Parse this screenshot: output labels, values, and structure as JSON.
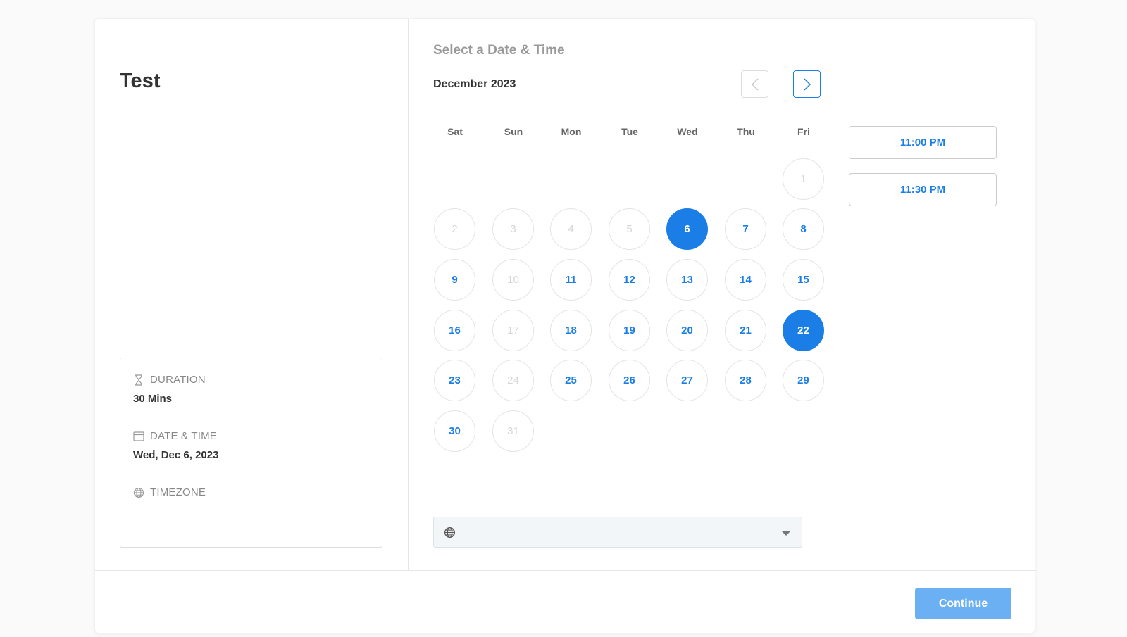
{
  "event": {
    "title": "Test"
  },
  "details": {
    "duration": {
      "label": "DURATION",
      "value": "30 Mins",
      "icon": "hourglass-icon"
    },
    "datetime": {
      "label": "DATE & TIME",
      "value": "Wed, Dec 6, 2023",
      "icon": "calendar-icon"
    },
    "timezone": {
      "label": "TIMEZONE",
      "value": "",
      "icon": "globe-icon"
    }
  },
  "scheduler": {
    "title": "Select a Date & Time",
    "month": "December 2023",
    "weekdays": [
      "Sat",
      "Sun",
      "Mon",
      "Tue",
      "Wed",
      "Thu",
      "Fri"
    ],
    "first_weekday_index": 6,
    "days": [
      {
        "n": "1",
        "state": "disabled"
      },
      {
        "n": "2",
        "state": "disabled"
      },
      {
        "n": "3",
        "state": "disabled"
      },
      {
        "n": "4",
        "state": "disabled"
      },
      {
        "n": "5",
        "state": "disabled"
      },
      {
        "n": "6",
        "state": "selected"
      },
      {
        "n": "7",
        "state": "available"
      },
      {
        "n": "8",
        "state": "available"
      },
      {
        "n": "9",
        "state": "available"
      },
      {
        "n": "10",
        "state": "disabled"
      },
      {
        "n": "11",
        "state": "available"
      },
      {
        "n": "12",
        "state": "available"
      },
      {
        "n": "13",
        "state": "available"
      },
      {
        "n": "14",
        "state": "available"
      },
      {
        "n": "15",
        "state": "available"
      },
      {
        "n": "16",
        "state": "available"
      },
      {
        "n": "17",
        "state": "disabled"
      },
      {
        "n": "18",
        "state": "available"
      },
      {
        "n": "19",
        "state": "available"
      },
      {
        "n": "20",
        "state": "available"
      },
      {
        "n": "21",
        "state": "available"
      },
      {
        "n": "22",
        "state": "selected"
      },
      {
        "n": "23",
        "state": "available"
      },
      {
        "n": "24",
        "state": "disabled"
      },
      {
        "n": "25",
        "state": "available"
      },
      {
        "n": "26",
        "state": "available"
      },
      {
        "n": "27",
        "state": "available"
      },
      {
        "n": "28",
        "state": "available"
      },
      {
        "n": "29",
        "state": "available"
      },
      {
        "n": "30",
        "state": "available"
      },
      {
        "n": "31",
        "state": "disabled"
      }
    ],
    "time_slots": [
      "11:00 PM",
      "11:30 PM"
    ],
    "timezone_select": {
      "value": "",
      "icon": "globe-icon"
    }
  },
  "footer": {
    "continue_label": "Continue"
  },
  "colors": {
    "accent": "#1a7ee6",
    "continue_bg": "#6cb0f4",
    "disabled_text": "#d6d6d6"
  }
}
